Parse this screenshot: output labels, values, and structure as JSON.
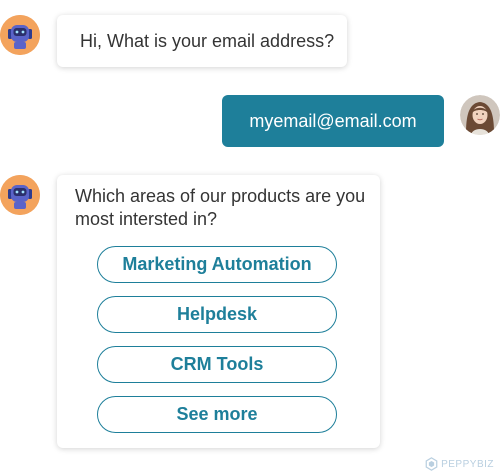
{
  "bot": {
    "avatar_icon": "robot-icon",
    "question": "Hi, What is your email address?"
  },
  "user": {
    "avatar_icon": "user-photo",
    "reply": "myemail@email.com"
  },
  "options_card": {
    "prompt": "Which areas of our products are you most intersted in?",
    "options": [
      {
        "label": "Marketing Automation"
      },
      {
        "label": "Helpdesk"
      },
      {
        "label": "CRM Tools"
      },
      {
        "label": "See more"
      }
    ]
  },
  "branding": {
    "logo_text": "PEPPYBIZ",
    "logo_icon": "hexagon-logo-icon"
  },
  "colors": {
    "accent": "#1e7f9a",
    "bot_avatar_bg": "#f3a35d",
    "text": "#343434"
  }
}
